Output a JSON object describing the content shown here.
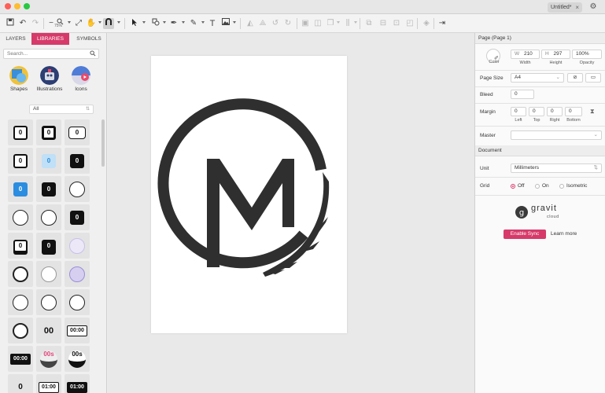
{
  "window": {
    "tab_title": "Untitled*",
    "tab_close": "×"
  },
  "toolbar": {
    "zoom_value": "75%",
    "text_tool": "T"
  },
  "left_panel": {
    "tabs": [
      "LAYERS",
      "LIBRARIES",
      "SYMBOLS"
    ],
    "active_tab": "LIBRARIES",
    "search_placeholder": "Search...",
    "libraries": [
      "Shapes",
      "Illustrations",
      "Icons"
    ],
    "filter_value": "All",
    "grid_items": [
      [
        "0",
        "0",
        "0"
      ],
      [
        "0",
        "0",
        "0"
      ],
      [
        "0",
        "0",
        ""
      ],
      [
        "",
        "",
        "0"
      ],
      [
        "0",
        "0",
        ""
      ],
      [
        "",
        "",
        ""
      ],
      [
        "",
        "",
        ""
      ],
      [
        "",
        "00",
        "00:00"
      ],
      [
        "00:00",
        "00s",
        "00s"
      ],
      [
        "0",
        "01:00",
        "01:00"
      ]
    ]
  },
  "right_panel": {
    "header": "Page (Page 1)",
    "color_label": "Color",
    "width_prefix": "W",
    "width_value": "210",
    "width_label": "Width",
    "height_prefix": "H",
    "height_value": "297",
    "height_label": "Height",
    "opacity_value": "100%",
    "opacity_label": "Opacity",
    "page_size_label": "Page Size",
    "page_size_value": "A4",
    "bleed_label": "Bleed",
    "bleed_value": "0",
    "margin_label": "Margin",
    "margins": [
      {
        "value": "0",
        "label": "Left"
      },
      {
        "value": "0",
        "label": "Top"
      },
      {
        "value": "0",
        "label": "Right"
      },
      {
        "value": "0",
        "label": "Bottom"
      }
    ],
    "master_label": "Master",
    "document_header": "Document",
    "unit_label": "Unit",
    "unit_value": "Millimeters",
    "grid_label": "Grid",
    "grid_options": [
      "Off",
      "On",
      "Isometric"
    ],
    "grid_selected": "Off",
    "brand_name": "gravit",
    "brand_sub": "cloud",
    "sync_button": "Enable Sync",
    "learn_more": "Learn more"
  },
  "colors": {
    "accent": "#d63a6a",
    "logo": "#2f2f2f"
  }
}
